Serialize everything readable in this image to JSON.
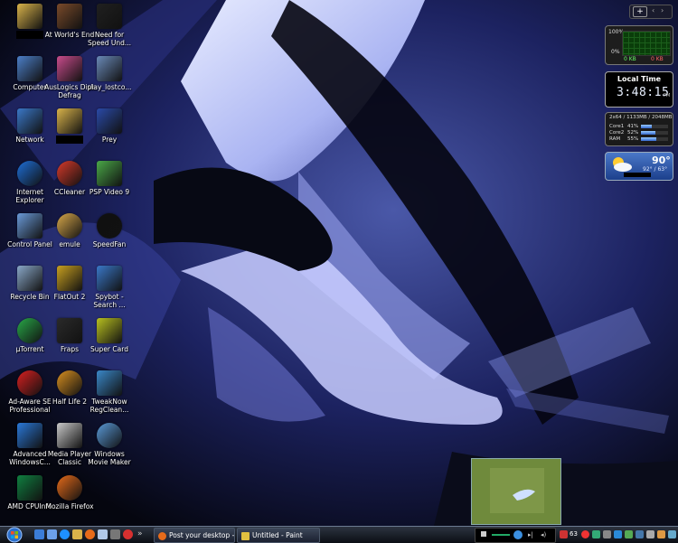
{
  "desktop": {
    "icons": [
      {
        "label": "",
        "name": "folder-redacted",
        "icon": "folder-icon",
        "redacted": true
      },
      {
        "label": "At World's End",
        "name": "at-worlds-end",
        "icon": "pirate-game-icon"
      },
      {
        "label": "Need for Speed Und...",
        "name": "need-for-speed",
        "icon": "nfs-icon"
      },
      {
        "label": "Computer",
        "name": "computer",
        "icon": "computer-icon"
      },
      {
        "label": "AusLogics Disk Defrag",
        "name": "auslogics-disk-defrag",
        "icon": "defrag-icon"
      },
      {
        "label": "play_lostco...",
        "name": "play-lostco",
        "icon": "settings-file-icon"
      },
      {
        "label": "Network",
        "name": "network",
        "icon": "network-icon"
      },
      {
        "label": "",
        "name": "folder-redacted-2",
        "icon": "folder-icon",
        "redacted": true
      },
      {
        "label": "Prey",
        "name": "prey",
        "icon": "prey-icon"
      },
      {
        "label": "Internet Explorer",
        "name": "internet-explorer",
        "icon": "ie-icon"
      },
      {
        "label": "CCleaner",
        "name": "ccleaner",
        "icon": "ccleaner-icon"
      },
      {
        "label": "PSP Video 9",
        "name": "psp-video-9",
        "icon": "psp-video-icon"
      },
      {
        "label": "Control Panel",
        "name": "control-panel",
        "icon": "control-panel-icon"
      },
      {
        "label": "emule",
        "name": "emule",
        "icon": "emule-icon"
      },
      {
        "label": "SpeedFan",
        "name": "speedfan",
        "icon": "fan-icon"
      },
      {
        "label": "Recycle Bin",
        "name": "recycle-bin",
        "icon": "recycle-bin-icon"
      },
      {
        "label": "FlatOut 2",
        "name": "flatout-2",
        "icon": "flatout-icon"
      },
      {
        "label": "Spybot - Search ...",
        "name": "spybot",
        "icon": "spybot-icon"
      },
      {
        "label": "µTorrent",
        "name": "utorrent",
        "icon": "utorrent-icon"
      },
      {
        "label": "Fraps",
        "name": "fraps",
        "icon": "fraps-icon"
      },
      {
        "label": "Super Card",
        "name": "super-card",
        "icon": "lightning-icon"
      },
      {
        "label": "Ad-Aware SE Professional",
        "name": "ad-aware",
        "icon": "adaware-icon"
      },
      {
        "label": "Half Life 2",
        "name": "half-life-2",
        "icon": "lambda-icon"
      },
      {
        "label": "TweakNow RegClean...",
        "name": "tweaknow",
        "icon": "regclean-icon"
      },
      {
        "label": "Advanced WindowsC...",
        "name": "advanced-windowscare",
        "icon": "windowscare-icon"
      },
      {
        "label": "Media Player Classic",
        "name": "media-player-classic",
        "icon": "mpc-icon"
      },
      {
        "label": "Windows Movie Maker",
        "name": "movie-maker",
        "icon": "movie-maker-icon"
      },
      {
        "label": "AMD CPUInfo",
        "name": "amd-cpuinfo",
        "icon": "amd-icon"
      },
      {
        "label": "Mozilla Firefox",
        "name": "mozilla-firefox",
        "icon": "firefox-icon"
      }
    ]
  },
  "gadgets": {
    "network": {
      "top_label": "100%",
      "bottom_label": "0%",
      "sent": "0 KB",
      "received": "0 KB"
    },
    "clock": {
      "title": "Local Time",
      "time": "3:48:15",
      "meridiem": "PM"
    },
    "cpu": {
      "header": "2x64 / 1133MB / 2048MB",
      "rows": [
        {
          "label": "Core1",
          "value": "41%",
          "pct": 41
        },
        {
          "label": "Core2",
          "value": "52%",
          "pct": 52
        },
        {
          "label": "RAM",
          "value": "55%",
          "pct": 55
        }
      ]
    },
    "weather": {
      "temp": "90°",
      "range": "92° / 63°"
    }
  },
  "taskbar": {
    "windows": [
      {
        "label": "Post your desktop - ...",
        "name": "taskbar-post-your-desktop"
      },
      {
        "label": "Untitled - Paint",
        "name": "taskbar-untitled-paint"
      }
    ],
    "tray": {
      "volume_level": "63"
    }
  },
  "colors": {
    "accent": "#3a4fa0",
    "taskbar": "#1a1f2a"
  }
}
